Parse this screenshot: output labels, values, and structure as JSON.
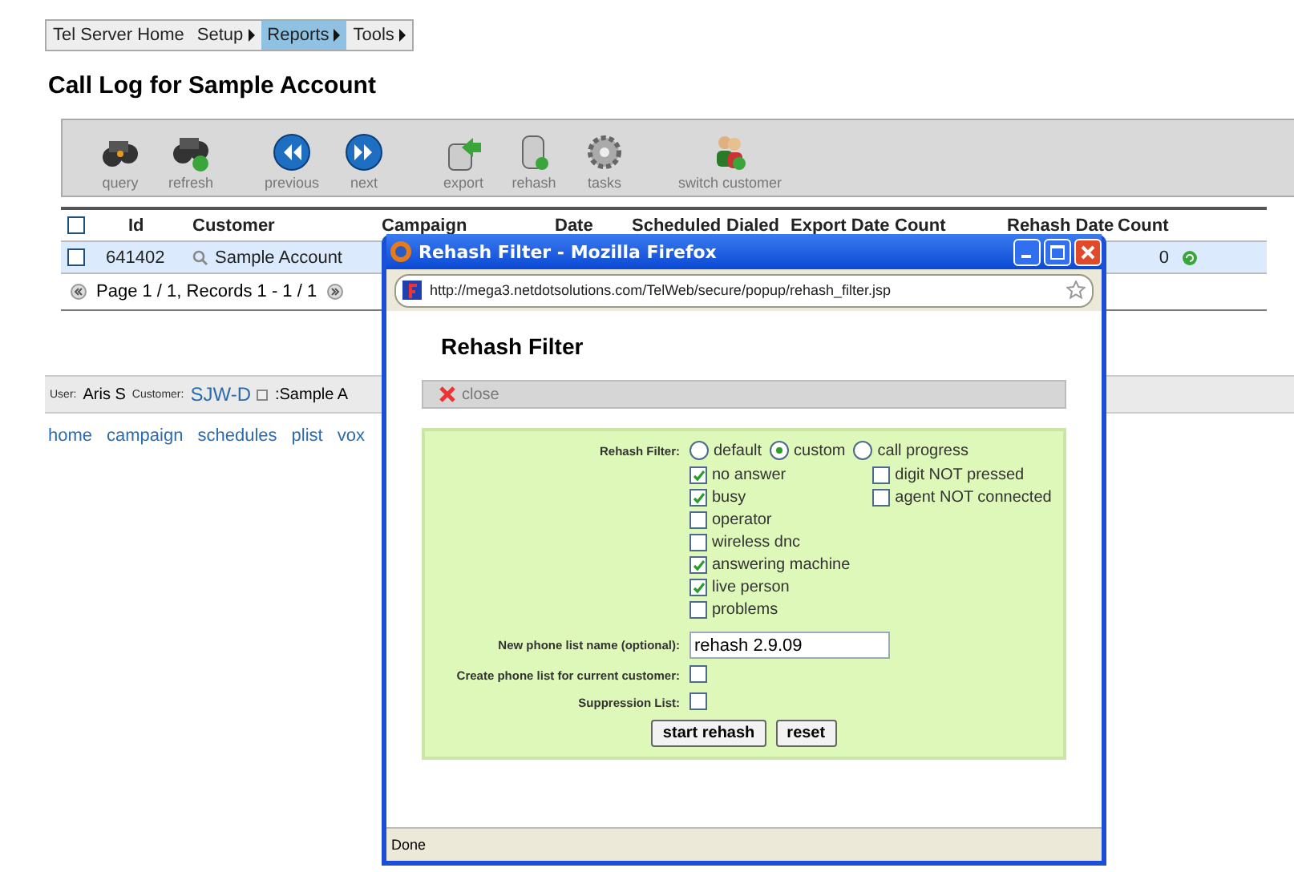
{
  "menu": [
    {
      "label": "Tel Server Home",
      "has_submenu": false,
      "selected": false
    },
    {
      "label": "Setup",
      "has_submenu": true,
      "selected": false
    },
    {
      "label": "Reports",
      "has_submenu": true,
      "selected": true
    },
    {
      "label": "Tools",
      "has_submenu": true,
      "selected": false
    }
  ],
  "page_title": "Call Log for Sample Account",
  "toolbar": [
    "query",
    "refresh",
    "previous",
    "next",
    "export",
    "rehash",
    "tasks",
    "switch customer"
  ],
  "table": {
    "header_checked": false,
    "columns": [
      "Id",
      "Customer",
      "Campaign",
      "Date",
      "Scheduled",
      "Dialed",
      "Export Date",
      "Count",
      "Rehash Date",
      "Count"
    ],
    "rows": [
      {
        "checked": false,
        "selected": true,
        "id": "641402",
        "customer": "Sample Account",
        "count": "0"
      }
    ],
    "pagination": "Page 1 / 1, Records 1 - 1 / 1"
  },
  "status": {
    "user_label": "User:",
    "user": "Aris S",
    "customer_label": "Customer:",
    "customer": "SJW-D",
    "customer_name": ":Sample A"
  },
  "links": [
    "home",
    "campaign",
    "schedules",
    "plist",
    "vox"
  ],
  "popup": {
    "title": "Rehash Filter - Mozilla Firefox",
    "url": "http://mega3.netdotsolutions.com/TelWeb/secure/popup/rehash_filter.jsp",
    "heading": "Rehash Filter",
    "close": "close",
    "filter_label": "Rehash Filter:",
    "radios": [
      {
        "label": "default",
        "selected": false
      },
      {
        "label": "custom",
        "selected": true
      },
      {
        "label": "call progress",
        "selected": false
      }
    ],
    "checks_left": [
      {
        "label": "no answer",
        "checked": true
      },
      {
        "label": "busy",
        "checked": true
      },
      {
        "label": "operator",
        "checked": false
      },
      {
        "label": "wireless dnc",
        "checked": false
      },
      {
        "label": "answering machine",
        "checked": true
      },
      {
        "label": "live person",
        "checked": true
      },
      {
        "label": "problems",
        "checked": false
      }
    ],
    "checks_right": [
      {
        "label": "digit NOT pressed",
        "checked": false
      },
      {
        "label": "agent NOT connected",
        "checked": false
      }
    ],
    "list_name_label": "New phone list name (optional):",
    "list_name": "rehash 2.9.09",
    "create_label": "Create phone list for current customer:",
    "create_checked": false,
    "suppression_label": "Suppression List:",
    "suppression_checked": false,
    "buttons": [
      "start rehash",
      "reset"
    ],
    "status": "Done"
  }
}
